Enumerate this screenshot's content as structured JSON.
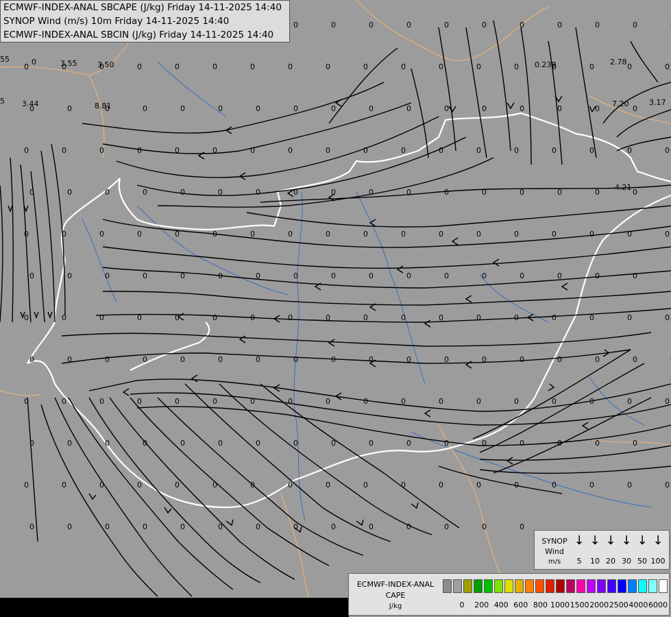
{
  "header": {
    "line1": "ECMWF-INDEX-ANAL SBCAPE (J/kg) Friday 14-11-2025 14:40",
    "line2": "SYNOP Wind (m/s) 10m Friday 14-11-2025 14:40",
    "line3": "ECMWF-INDEX-ANAL SBCIN (J/kg) Friday 14-11-2025 14:40"
  },
  "map_values": [
    "0",
    "3.55",
    "3.50",
    "3.44",
    "8.81",
    "0.239",
    "2.78",
    "7.20",
    "3.17",
    "4.21",
    "55",
    "5"
  ],
  "wind_legend": {
    "title": [
      "SYNOP",
      "Wind",
      "m/s"
    ],
    "values": [
      "5",
      "10",
      "20",
      "30",
      "50",
      "100"
    ],
    "arrow_glyph": "↓"
  },
  "cape_legend": {
    "title_line1": "ECMWF-INDEX-ANAL",
    "title_line2": "CAPE",
    "title_line3": "J/kg",
    "ticks": [
      "0",
      "200",
      "400",
      "600",
      "800",
      "1000",
      "1500",
      "2000",
      "2500",
      "4000",
      "6000"
    ],
    "colors": [
      "#8c8c8c",
      "#a0a0a0",
      "#a0a000",
      "#00a000",
      "#00c000",
      "#80e000",
      "#e0e000",
      "#e0b000",
      "#ff8000",
      "#ff5000",
      "#e02000",
      "#b00000",
      "#c00060",
      "#ff00b0",
      "#c000ff",
      "#8000ff",
      "#4000ff",
      "#0000ff",
      "#0080ff",
      "#00ffff",
      "#80ffff",
      "#ffffff"
    ]
  },
  "colors": {
    "background": "#9c9c9c",
    "streamline": "#000000",
    "border_main": "#ffffff",
    "border_other": "#e0b080",
    "river": "#3070c0"
  }
}
